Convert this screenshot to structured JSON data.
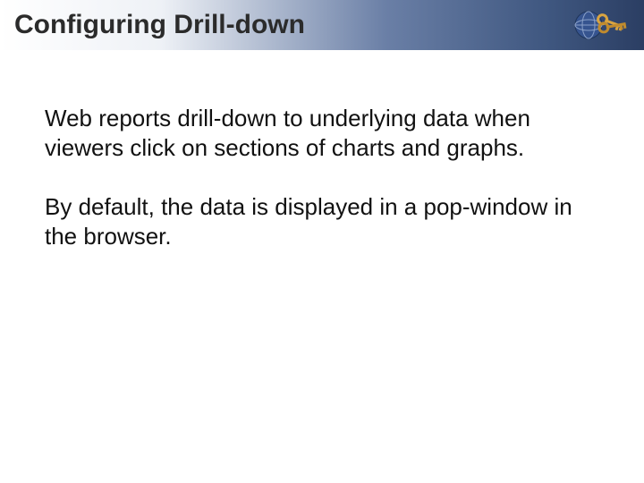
{
  "header": {
    "title": "Configuring Drill-down"
  },
  "body": {
    "paragraph1": "Web reports drill-down to underlying data when viewers click on sections of charts and graphs.",
    "paragraph2": "By default, the data is displayed in a pop-window in the browser."
  }
}
